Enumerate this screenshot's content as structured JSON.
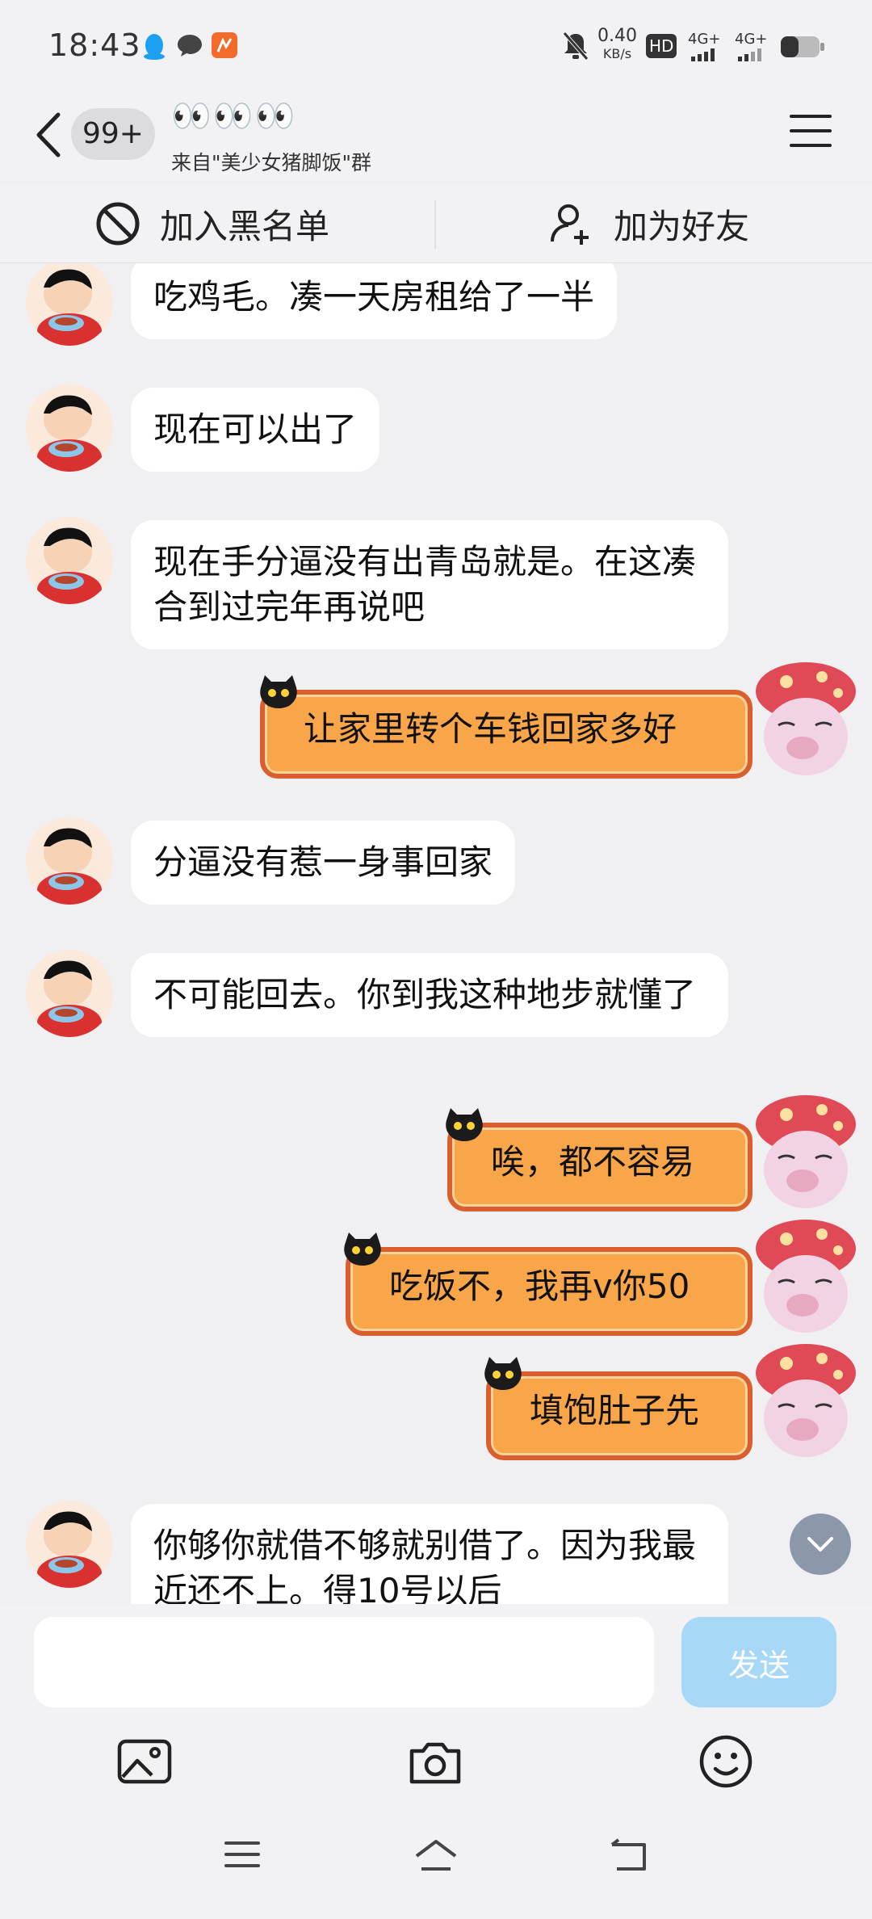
{
  "status_bar": {
    "time": "18:43",
    "net_speed": "0.40",
    "net_unit": "KB/s",
    "hd_label": "HD",
    "sim1": "4G+",
    "sim2": "4G+"
  },
  "header": {
    "unread": "99+",
    "title": "👀👀👀",
    "subtitle": "来自\"美少女猪脚饭\"群"
  },
  "actions": {
    "block": "加入黑名单",
    "add_friend": "加为好友"
  },
  "messages": [
    {
      "from": "other",
      "text": "吃鸡毛。凑一天房租给了一半"
    },
    {
      "from": "other",
      "text": "现在可以出了"
    },
    {
      "from": "other",
      "text": "现在手分逼没有出青岛就是。在这凑合到过完年再说吧"
    },
    {
      "from": "me",
      "text": "让家里转个车钱回家多好"
    },
    {
      "from": "other",
      "text": "分逼没有惹一身事回家"
    },
    {
      "from": "other",
      "text": "不可能回去。你到我这种地步就懂了"
    },
    {
      "from": "me",
      "text": "唉，都不容易"
    },
    {
      "from": "me",
      "text": "吃饭不，我再v你50"
    },
    {
      "from": "me",
      "text": "填饱肚子先"
    },
    {
      "from": "other",
      "text": "你够你就借不够就别借了。因为我最近还不上。得10号以后"
    }
  ],
  "input": {
    "placeholder": "",
    "send_label": "发送"
  },
  "colors": {
    "send_disabled": "#a8d8f8",
    "my_bubble": "#f9a64a",
    "my_bubble_border": "#d9602e",
    "other_bubble": "#ffffff"
  },
  "icons": [
    "back-arrow-icon",
    "menu-icon",
    "block-icon",
    "add-friend-icon",
    "image-icon",
    "camera-icon",
    "emoji-icon",
    "chevron-down-icon"
  ]
}
